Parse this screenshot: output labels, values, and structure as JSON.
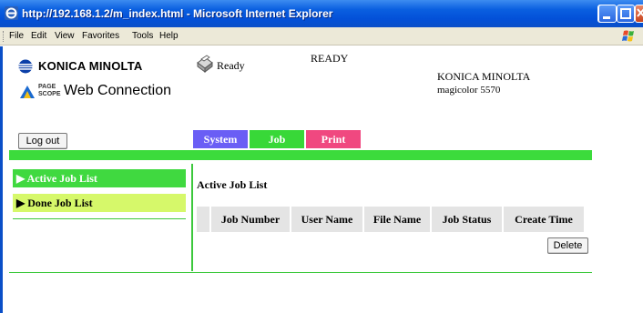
{
  "window": {
    "title": "http://192.168.1.2/m_index.html - Microsoft Internet Explorer",
    "controls": [
      "minimize",
      "maximize",
      "close"
    ]
  },
  "menu": {
    "items": [
      "File",
      "Edit",
      "View",
      "Favorites",
      "Tools",
      "Help"
    ]
  },
  "header": {
    "brand": "KONICA MINOLTA",
    "pagescope_small_1": "PAGE",
    "pagescope_small_2": "SCOPE",
    "pagescope_label": "Web Connection",
    "printer_status_small": "Ready",
    "printer_status_big": "READY",
    "model_line1": "KONICA MINOLTA",
    "model_line2": "magicolor 5570",
    "logout_label": "Log out"
  },
  "tabs": [
    {
      "label": "System",
      "color": "#6a5ef5"
    },
    {
      "label": "Job",
      "color": "#38d838"
    },
    {
      "label": "Print",
      "color": "#f04880"
    }
  ],
  "sidebar": {
    "items": [
      {
        "label": "▶ Active Job List",
        "active": true
      },
      {
        "label": "▶ Done Job List",
        "active": false
      }
    ]
  },
  "main": {
    "title": "Active Job List",
    "table": {
      "columns": [
        "Job Number",
        "User Name",
        "File Name",
        "Job Status",
        "Create Time"
      ],
      "rows": []
    },
    "delete_label": "Delete"
  },
  "colors": {
    "accent_green": "#3cdb3c",
    "sidebar_active": "#40d940",
    "sidebar_inactive": "#d6f86a",
    "titlebar_blue": "#0350d8"
  }
}
